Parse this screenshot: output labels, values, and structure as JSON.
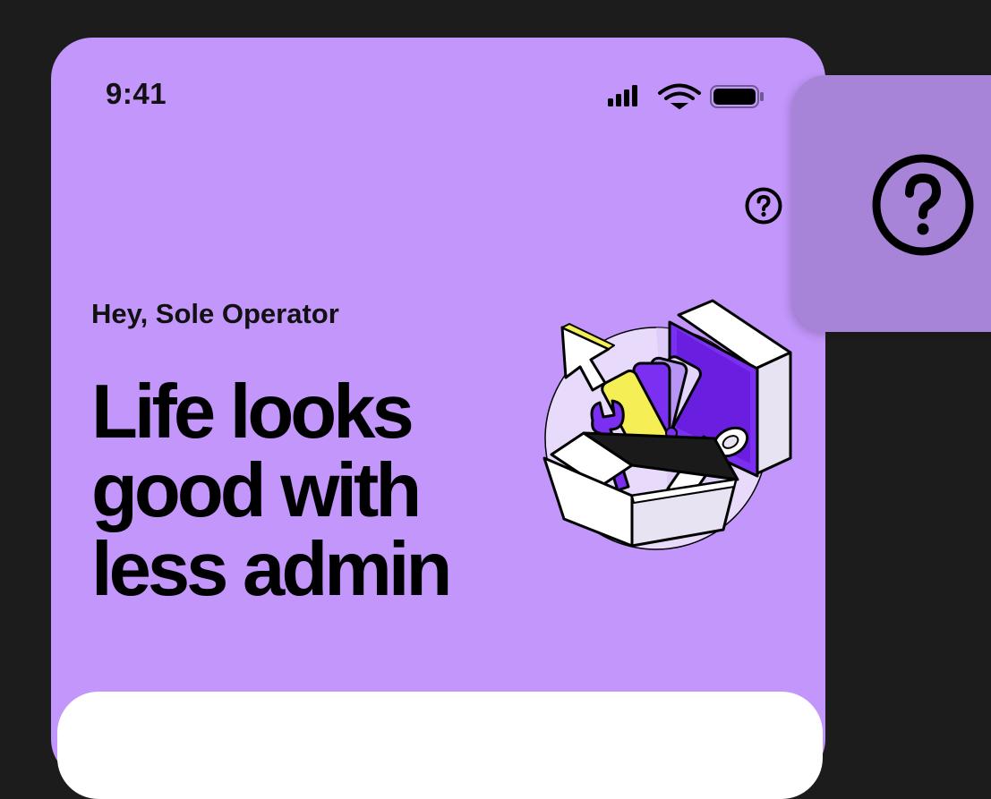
{
  "status_bar": {
    "time": "9:41",
    "icons": [
      "signal-icon",
      "wifi-icon",
      "battery-icon"
    ]
  },
  "header": {
    "help_icon": "question-circle-icon"
  },
  "hero": {
    "greeting": "Hey, Sole Operator",
    "headline_lines": [
      "Life looks",
      "good with",
      "less admin"
    ],
    "illustration": "admin-toolbox-illustration"
  },
  "side_panel": {
    "icon": "question-circle-icon"
  },
  "colors": {
    "page_background": "#1c1c1c",
    "phone_background": "#c296fb",
    "side_panel": "#a884d8",
    "illustration_purple": "#6a1fe0",
    "illustration_yellow": "#f5ee54",
    "card": "#ffffff"
  }
}
